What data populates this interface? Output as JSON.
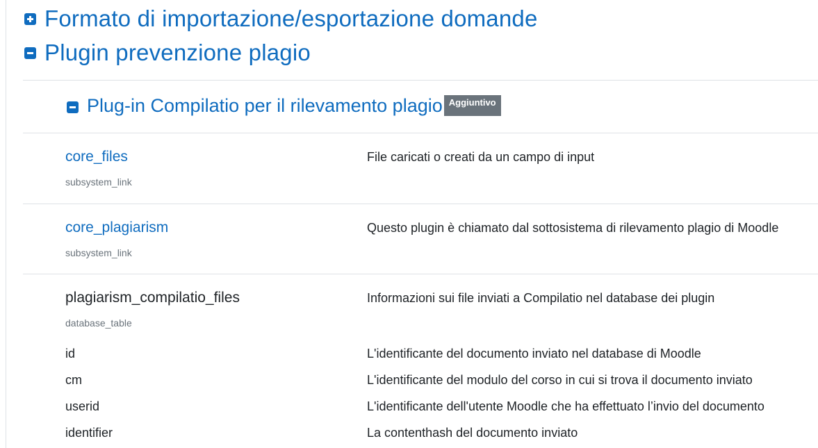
{
  "sections": {
    "format": {
      "title": "Formato di importazione/esportazione domande"
    },
    "plagiarism": {
      "title": "Plugin prevenzione plagio"
    },
    "compilatio": {
      "title": "Plug-in Compilatio per il rilevamento plagio",
      "badge": "Aggiuntivo"
    }
  },
  "items": [
    {
      "name": "core_files",
      "type": "subsystem_link",
      "description": "File caricati o creati da un campo di input"
    },
    {
      "name": "core_plagiarism",
      "type": "subsystem_link",
      "description": "Questo plugin è chiamato dal sottosistema di rilevamento plagio di Moodle"
    },
    {
      "name": "plagiarism_compilatio_files",
      "type": "database_table",
      "description": "Informazioni sui file inviati a Compilatio nel database dei plugin"
    }
  ],
  "fields": [
    {
      "name": "id",
      "description": "L'identificante del documento inviato nel database di Moodle"
    },
    {
      "name": "cm",
      "description": "L'identificante del modulo del corso in cui si trova il documento inviato"
    },
    {
      "name": "userid",
      "description": "L'identificante dell'utente Moodle che ha effettuato l’invio del documento"
    },
    {
      "name": "identifier",
      "description": "La contenthash del documento inviato"
    }
  ],
  "colors": {
    "link": "#0f6cbf",
    "badge": "#6a737b",
    "muted": "#6a737b",
    "rule": "#dee2e6"
  },
  "icons": {
    "expand": "plus-square-icon",
    "collapse": "minus-square-icon"
  }
}
